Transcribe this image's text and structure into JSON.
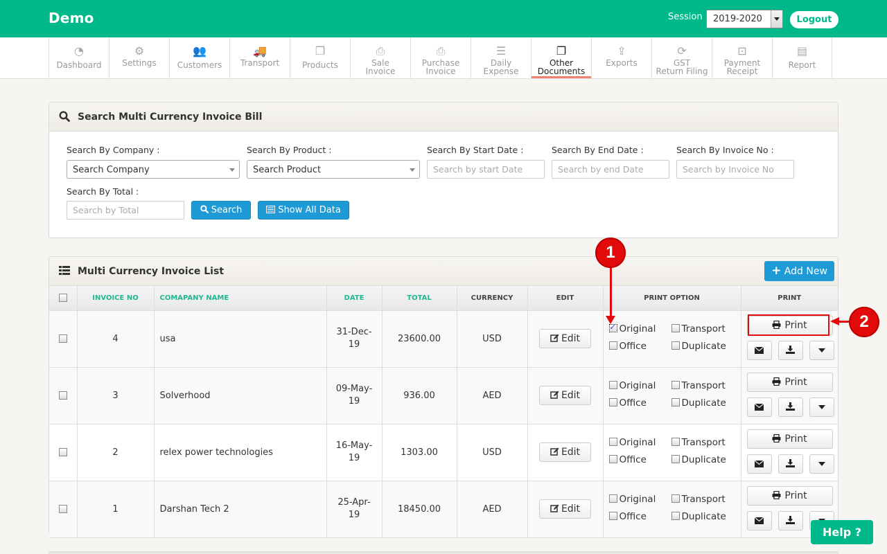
{
  "app": {
    "title": "Demo"
  },
  "session": {
    "label": "Session :",
    "value": "2019-2020"
  },
  "logout_label": "Logout",
  "nav": [
    {
      "id": "dashboard",
      "icon": "dashboard-icon",
      "glyph": "◔",
      "label1": "Dashboard",
      "label2": ""
    },
    {
      "id": "settings",
      "icon": "gear-icon",
      "glyph": "⚙",
      "label1": "Settings",
      "label2": ""
    },
    {
      "id": "customers",
      "icon": "users-icon",
      "glyph": "👥",
      "label1": "Customers",
      "label2": ""
    },
    {
      "id": "transport",
      "icon": "truck-icon",
      "glyph": "🚚",
      "label1": "Transport",
      "label2": ""
    },
    {
      "id": "products",
      "icon": "cubes-icon",
      "glyph": "❒",
      "label1": "Products",
      "label2": ""
    },
    {
      "id": "sale-invoice",
      "icon": "printer-icon",
      "glyph": "⎙",
      "label1": "Sale",
      "label2": "Invoice"
    },
    {
      "id": "purchase-invoice",
      "icon": "printer-icon",
      "glyph": "⎙",
      "label1": "Purchase",
      "label2": "Invoice"
    },
    {
      "id": "daily-expense",
      "icon": "server-icon",
      "glyph": "☰",
      "label1": "Daily",
      "label2": "Expense"
    },
    {
      "id": "other-documents",
      "icon": "documents-icon",
      "glyph": "❐",
      "label1": "Other",
      "label2": "Documents",
      "active": true
    },
    {
      "id": "exports",
      "icon": "upload-icon",
      "glyph": "⇪",
      "label1": "Exports",
      "label2": ""
    },
    {
      "id": "gst-return-filing",
      "icon": "refresh-icon",
      "glyph": "⟳",
      "label1": "GST",
      "label2": "Return Filing"
    },
    {
      "id": "payment-receipt",
      "icon": "money-icon",
      "glyph": "⊡",
      "label1": "Payment",
      "label2": "Receipt"
    },
    {
      "id": "report",
      "icon": "newspaper-icon",
      "glyph": "▤",
      "label1": "Report",
      "label2": ""
    }
  ],
  "search_panel": {
    "title": "Search Multi Currency Invoice Bill",
    "company": {
      "label": "Search By Company :",
      "value": "Search Company"
    },
    "product": {
      "label": "Search By Product :",
      "value": "Search Product"
    },
    "start_date": {
      "label": "Search By Start Date :",
      "placeholder": "Search by start Date"
    },
    "end_date": {
      "label": "Search By End Date :",
      "placeholder": "Search by end Date"
    },
    "invoice_no": {
      "label": "Search By Invoice No :",
      "placeholder": "Search by Invoice No"
    },
    "total": {
      "label": "Search By Total :",
      "placeholder": "Search by Total"
    },
    "search_button": "Search",
    "show_all_button": "Show All Data"
  },
  "list_panel": {
    "title": "Multi Currency Invoice List",
    "add_new": "Add New",
    "columns": [
      "INVOICE NO",
      "COMAPANY NAME",
      "DATE",
      "TOTAL",
      "CURRENCY",
      "EDIT",
      "PRINT OPTION",
      "PRINT"
    ],
    "edit_label": "Edit",
    "print_label": "Print",
    "print_options": [
      "Original",
      "Transport",
      "Office",
      "Duplicate"
    ],
    "rows": [
      {
        "invoice_no": "4",
        "company": "usa",
        "date": "31-Dec-19",
        "total": "23600.00",
        "currency": "USD",
        "original_checked": true
      },
      {
        "invoice_no": "3",
        "company": "Solverhood",
        "date": "09-May-19",
        "total": "936.00",
        "currency": "AED",
        "original_checked": false
      },
      {
        "invoice_no": "2",
        "company": "relex power technologies",
        "date": "16-May-19",
        "total": "1303.00",
        "currency": "USD",
        "original_checked": false
      },
      {
        "invoice_no": "1",
        "company": "Darshan Tech 2",
        "date": "25-Apr-19",
        "total": "18450.00",
        "currency": "AED",
        "original_checked": false
      }
    ]
  },
  "annotations": [
    {
      "number": "1"
    },
    {
      "number": "2"
    }
  ],
  "help_label": "Help ?",
  "colors": {
    "brand": "#00b98a",
    "primary_button": "#1e9ad6",
    "annotation": "#e20a0a",
    "active_tab_underline": "#f08070"
  }
}
